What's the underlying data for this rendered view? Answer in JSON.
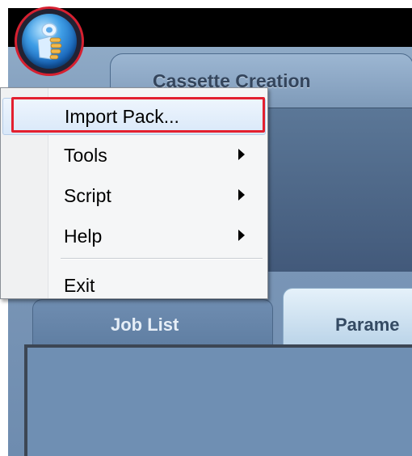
{
  "app": {
    "main_tab": "Cassette Creation",
    "sub_tabs": [
      "Job List",
      "Parame"
    ]
  },
  "app_button": {
    "icon": "app-orb-logo-icon"
  },
  "menu": {
    "items": [
      {
        "label": "Import Pack...",
        "has_submenu": false,
        "highlighted": true
      },
      {
        "label": "Tools",
        "has_submenu": true
      },
      {
        "label": "Script",
        "has_submenu": true
      },
      {
        "label": "Help",
        "has_submenu": true
      },
      {
        "label": "Exit",
        "has_submenu": false
      }
    ]
  },
  "colors": {
    "highlight_outline": "#e3202f",
    "menu_background": "#f5f6f7"
  }
}
